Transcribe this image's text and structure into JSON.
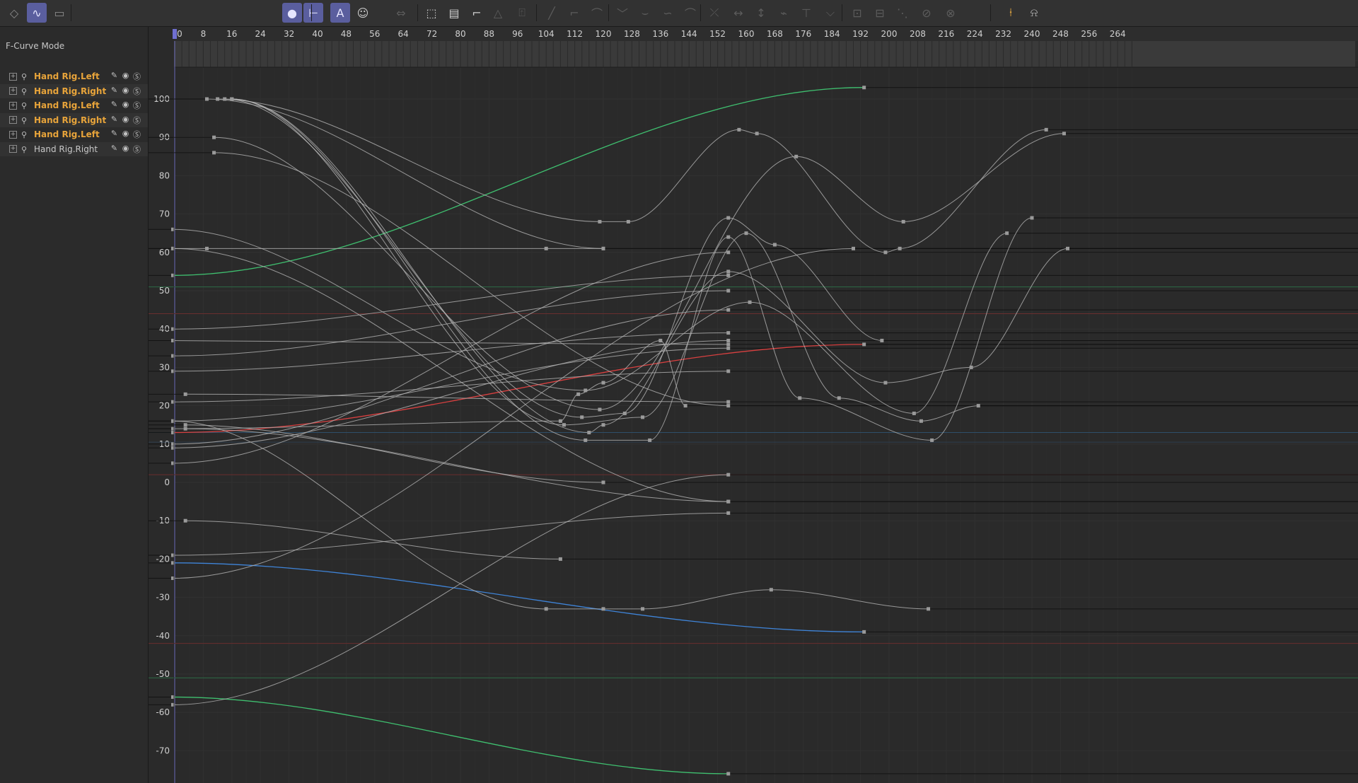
{
  "toolbar": {
    "left_icons": [
      "dopesheet-icon",
      "fcurve-icon",
      "motion-clip-icon"
    ],
    "mid_icons": [
      "sphere-icon",
      "hierarchy-icon",
      "text-a-icon",
      "person-icon",
      "move-horizontal-icon",
      "frame-selected-icon",
      "frame-all-icon",
      "tangent-icon",
      "triangle-icon",
      "weight-icon",
      "linear-icon",
      "step-icon",
      "ease-icon",
      "zero-angle-icon",
      "ease-in-icon",
      "ease-out-icon",
      "spline-icon",
      "break-tangent-icon",
      "lock-x-icon",
      "lock-y-icon",
      "clamp-icon",
      "auto-tangent-icon",
      "overshoot-icon",
      "lock-time-icon",
      "lock-value-icon",
      "remove-overshoot-icon",
      "zero-length-icon",
      "zero-weight-icon",
      "key-marker-icon",
      "add-marker-icon"
    ]
  },
  "panel": {
    "mode_label": "F-Curve Mode",
    "tracks": [
      {
        "name": "Hand Rig.Left",
        "highlight": true
      },
      {
        "name": "Hand Rig.Right",
        "highlight": true
      },
      {
        "name": "Hand Rig.Left",
        "highlight": true
      },
      {
        "name": "Hand Rig.Right",
        "highlight": true
      },
      {
        "name": "Hand Rig.Left",
        "highlight": true
      },
      {
        "name": "Hand Rig.Right",
        "highlight": false
      }
    ]
  },
  "timeline": {
    "frame_ticks": [
      "0",
      "8",
      "16",
      "24",
      "32",
      "40",
      "48",
      "56",
      "64",
      "72",
      "80",
      "88",
      "96",
      "104",
      "112",
      "120",
      "128",
      "136",
      "144",
      "152",
      "160",
      "168",
      "176",
      "184",
      "192",
      "200",
      "208",
      "216",
      "224",
      "232",
      "240",
      "248",
      "256",
      "264"
    ],
    "current_frame": 0,
    "value_ticks": [
      "100",
      "90",
      "80",
      "70",
      "60",
      "50",
      "40",
      "30",
      "20",
      "10",
      "0",
      "-10",
      "-20",
      "-30",
      "-40",
      "-50",
      "-60",
      "-70"
    ]
  },
  "colors": {
    "curve_default": "#b4b4b4",
    "curve_green": "#3fbf6f",
    "curve_red": "#d84040",
    "curve_blue": "#3f84d8",
    "track_highlight": "#e8a43a",
    "active_tool": "#5a5e9e"
  },
  "curves": [
    {
      "color": "curve_green",
      "keys": [
        [
          -0.5,
          54
        ],
        [
          193,
          103
        ]
      ]
    },
    {
      "color": "curve_red",
      "keys": [
        [
          -0.5,
          13
        ],
        [
          193,
          36
        ]
      ]
    },
    {
      "color": "curve_blue",
      "keys": [
        [
          -0.5,
          -21
        ],
        [
          193,
          -39
        ]
      ]
    },
    {
      "color": "curve_green",
      "keys": [
        [
          -0.5,
          -56
        ],
        [
          155,
          -76
        ]
      ]
    },
    {
      "color": "curve_default",
      "keys": [
        [
          9,
          100
        ],
        [
          120,
          61
        ]
      ]
    },
    {
      "color": "curve_default",
      "keys": [
        [
          12,
          100
        ],
        [
          119,
          68
        ],
        [
          127,
          68
        ],
        [
          158,
          92
        ],
        [
          163,
          91
        ],
        [
          199,
          60
        ],
        [
          203,
          61
        ],
        [
          244,
          92
        ]
      ]
    },
    {
      "color": "curve_default",
      "keys": [
        [
          14,
          100
        ],
        [
          114,
          17
        ],
        [
          126,
          18
        ],
        [
          155,
          69
        ],
        [
          168,
          62
        ],
        [
          198,
          37
        ]
      ]
    },
    {
      "color": "curve_default",
      "keys": [
        [
          16,
          100
        ],
        [
          109,
          15
        ],
        [
          131,
          17
        ],
        [
          160,
          65
        ],
        [
          186,
          22
        ],
        [
          209,
          16
        ],
        [
          225,
          20
        ]
      ]
    },
    {
      "color": "curve_default",
      "keys": [
        [
          16,
          100
        ],
        [
          115,
          11
        ],
        [
          133,
          11
        ],
        [
          155,
          64
        ],
        [
          175,
          22
        ],
        [
          212,
          11
        ],
        [
          240,
          69
        ]
      ]
    },
    {
      "color": "curve_default",
      "keys": [
        [
          16,
          100
        ],
        [
          116,
          13
        ],
        [
          120,
          15
        ],
        [
          155,
          55
        ],
        [
          199,
          26
        ],
        [
          223,
          30
        ],
        [
          250,
          61
        ]
      ]
    },
    {
      "color": "curve_default",
      "keys": [
        [
          11,
          90
        ],
        [
          119,
          19
        ],
        [
          174,
          85
        ],
        [
          204,
          68
        ],
        [
          249,
          91
        ]
      ]
    },
    {
      "color": "curve_default",
      "keys": [
        [
          11,
          86
        ],
        [
          155,
          20
        ]
      ]
    },
    {
      "color": "curve_default",
      "keys": [
        [
          -0.5,
          61
        ],
        [
          9,
          61
        ],
        [
          104,
          61
        ],
        [
          120,
          61
        ]
      ]
    },
    {
      "color": "curve_default",
      "keys": [
        [
          -0.5,
          66
        ],
        [
          115,
          24
        ],
        [
          161,
          47
        ],
        [
          207,
          18
        ],
        [
          233,
          65
        ]
      ]
    },
    {
      "color": "curve_default",
      "keys": [
        [
          -0.5,
          61
        ],
        [
          155,
          -5
        ]
      ]
    },
    {
      "color": "curve_default",
      "keys": [
        [
          -0.5,
          40
        ],
        [
          155,
          54
        ]
      ]
    },
    {
      "color": "curve_default",
      "keys": [
        [
          -0.5,
          37
        ],
        [
          155,
          36
        ]
      ]
    },
    {
      "color": "curve_default",
      "keys": [
        [
          -0.5,
          33
        ],
        [
          155,
          50
        ]
      ]
    },
    {
      "color": "curve_default",
      "keys": [
        [
          -0.5,
          29
        ],
        [
          155,
          39
        ]
      ]
    },
    {
      "color": "curve_default",
      "keys": [
        [
          -0.5,
          21
        ],
        [
          155,
          29
        ]
      ]
    },
    {
      "color": "curve_default",
      "keys": [
        [
          3,
          23
        ],
        [
          155,
          21
        ]
      ]
    },
    {
      "color": "curve_default",
      "keys": [
        [
          -0.5,
          16
        ],
        [
          155,
          35
        ]
      ]
    },
    {
      "color": "curve_default",
      "keys": [
        [
          -0.5,
          14
        ],
        [
          108,
          16
        ],
        [
          113,
          23
        ],
        [
          120,
          26
        ],
        [
          136,
          37
        ],
        [
          143,
          20
        ]
      ]
    },
    {
      "color": "curve_default",
      "keys": [
        [
          -0.5,
          10
        ],
        [
          155,
          45
        ]
      ]
    },
    {
      "color": "curve_default",
      "keys": [
        [
          -0.5,
          9
        ],
        [
          155,
          37
        ]
      ]
    },
    {
      "color": "curve_default",
      "keys": [
        [
          -0.5,
          5
        ],
        [
          155,
          60
        ]
      ]
    },
    {
      "color": "curve_default",
      "keys": [
        [
          3,
          15
        ],
        [
          120,
          0
        ]
      ]
    },
    {
      "color": "curve_default",
      "keys": [
        [
          3,
          14
        ],
        [
          155,
          -5
        ]
      ]
    },
    {
      "color": "curve_default",
      "keys": [
        [
          3,
          -10
        ],
        [
          108,
          -20
        ]
      ]
    },
    {
      "color": "curve_default",
      "keys": [
        [
          -0.5,
          -19
        ],
        [
          155,
          -8
        ]
      ]
    },
    {
      "color": "curve_default",
      "keys": [
        [
          -0.5,
          -25
        ],
        [
          190,
          61
        ]
      ]
    },
    {
      "color": "curve_default",
      "keys": [
        [
          -0.5,
          -58
        ],
        [
          155,
          2
        ]
      ]
    },
    {
      "color": "curve_default",
      "keys": [
        [
          -0.5,
          16
        ],
        [
          104,
          -33
        ],
        [
          120,
          -33
        ],
        [
          131,
          -33
        ],
        [
          167,
          -28
        ],
        [
          211,
          -33
        ]
      ]
    }
  ],
  "hlines": [
    {
      "value": 51,
      "color": "#2c6a46"
    },
    {
      "value": 44,
      "color": "#6a2e2e"
    },
    {
      "value": 13,
      "color": "#2e4f6a"
    },
    {
      "value": 10.5,
      "color": "#2e3e4e"
    },
    {
      "value": 2,
      "color": "#6a2e2e"
    },
    {
      "value": -42,
      "color": "#6a2e2e"
    },
    {
      "value": -51,
      "color": "#2c6a46"
    }
  ]
}
